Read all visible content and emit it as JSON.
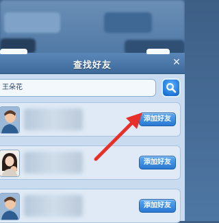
{
  "dialog": {
    "title": "查找好友",
    "close_glyph": "✕"
  },
  "search": {
    "value": "王朵花",
    "icon": "search-icon"
  },
  "results": [
    {
      "add_label": "添加好友"
    },
    {
      "add_label": "添加好友"
    },
    {
      "add_label": "添加好友"
    }
  ],
  "colors": {
    "title_bar": "#4a78a9",
    "button_blue": "#2a78d2",
    "arrow_red": "#e8302b"
  }
}
